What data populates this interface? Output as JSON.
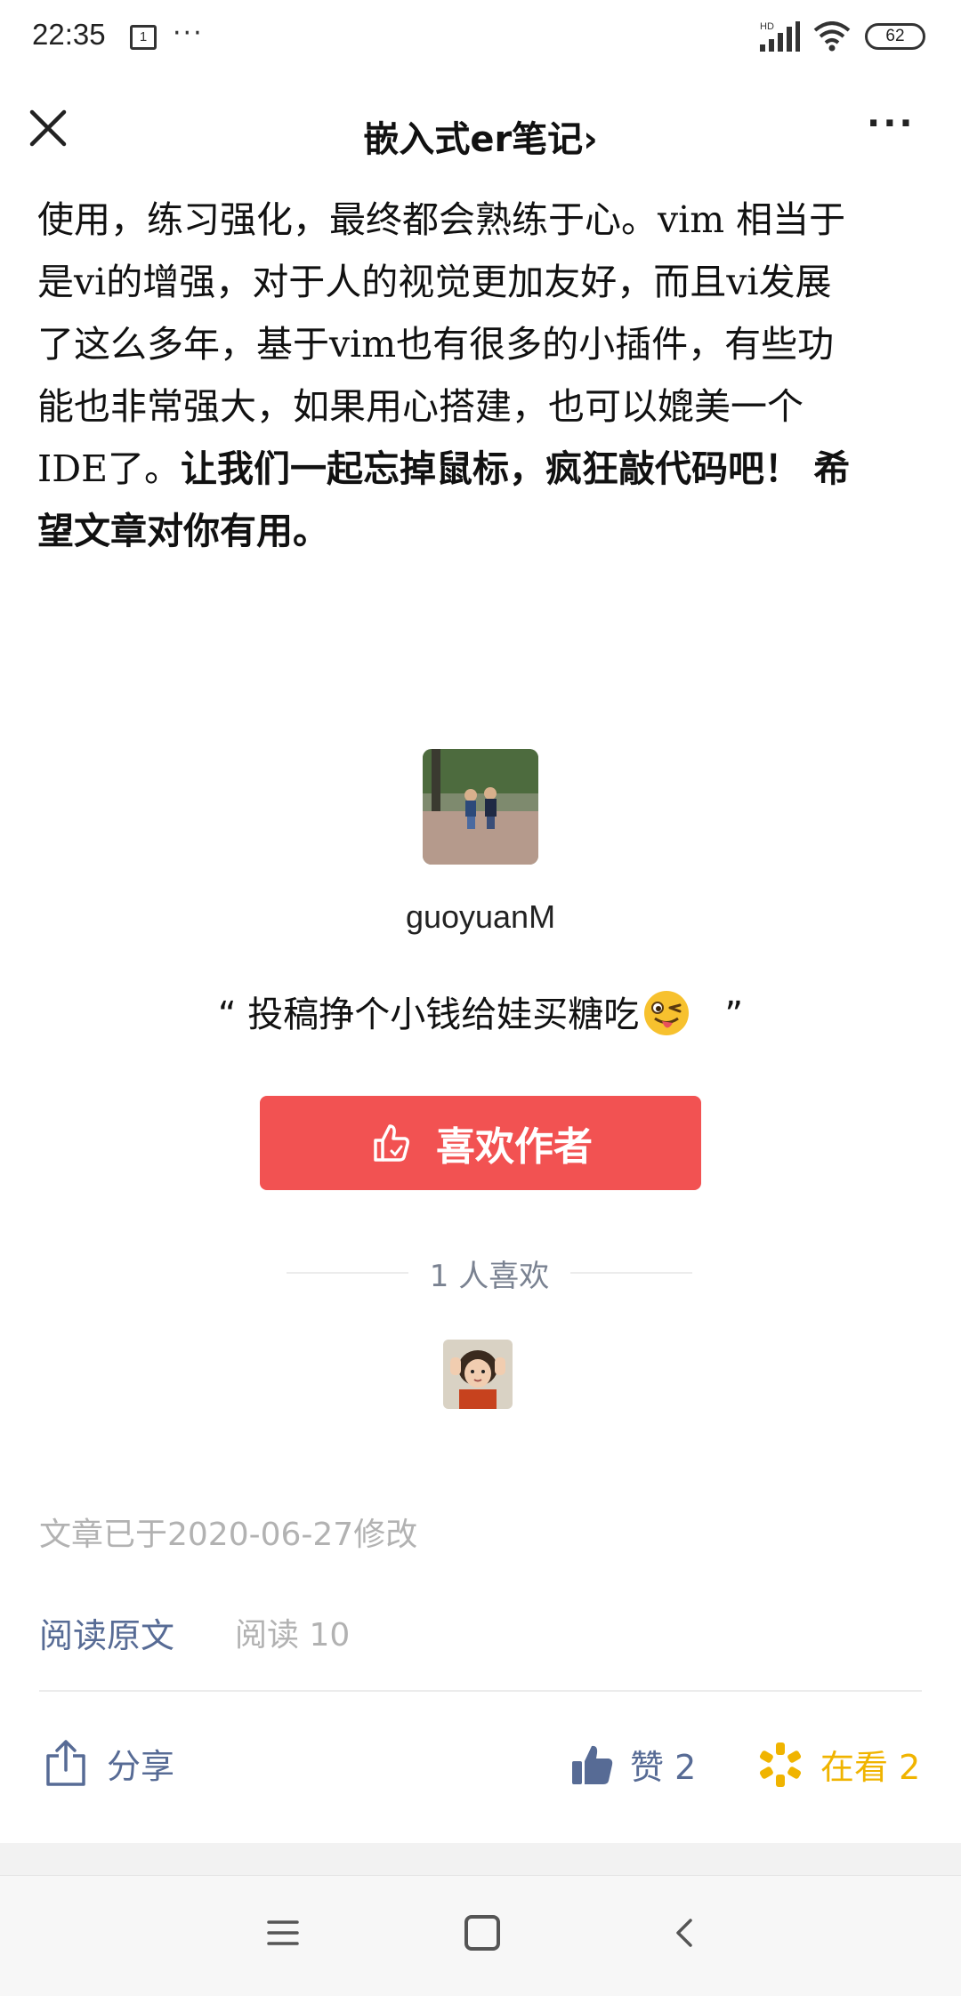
{
  "status_bar": {
    "time": "22:35",
    "calendar_day": "1",
    "more": "···",
    "network_label": "HD",
    "battery": "62"
  },
  "nav": {
    "title": "嵌入式er笔记",
    "chevron": "›",
    "more": "···"
  },
  "article": {
    "lines": [
      "使用，练习强化，最终都会熟练于心。vim 相当于",
      "是vi的增强，对于人的视觉更加友好，而且vi发展",
      "了这么多年，基于vim也有很多的小插件，有些功",
      "能也非常强大，如果用心搭建，也可以媲美一个"
    ],
    "line5_plain": "IDE了。",
    "line5_bold": "让我们一起忘掉鼠标，疯狂敲代码吧！ 希",
    "line6_bold": "望文章对你有用。"
  },
  "author": {
    "name": "guoyuanM",
    "quote_open": "“ 投稿挣个小钱给娃买糖吃",
    "quote_close": "”",
    "like_button": "喜欢作者",
    "liked_count": "1 人喜欢"
  },
  "meta": {
    "modified": "文章已于2020-06-27修改",
    "read_original": "阅读原文",
    "read_count": "阅读 10"
  },
  "actions": {
    "share": "分享",
    "zan": "赞 2",
    "looking": "在看 2"
  },
  "colors": {
    "like_button_bg": "#f25252",
    "link_blue": "#576b95",
    "looking_yellow": "#f0b400"
  }
}
